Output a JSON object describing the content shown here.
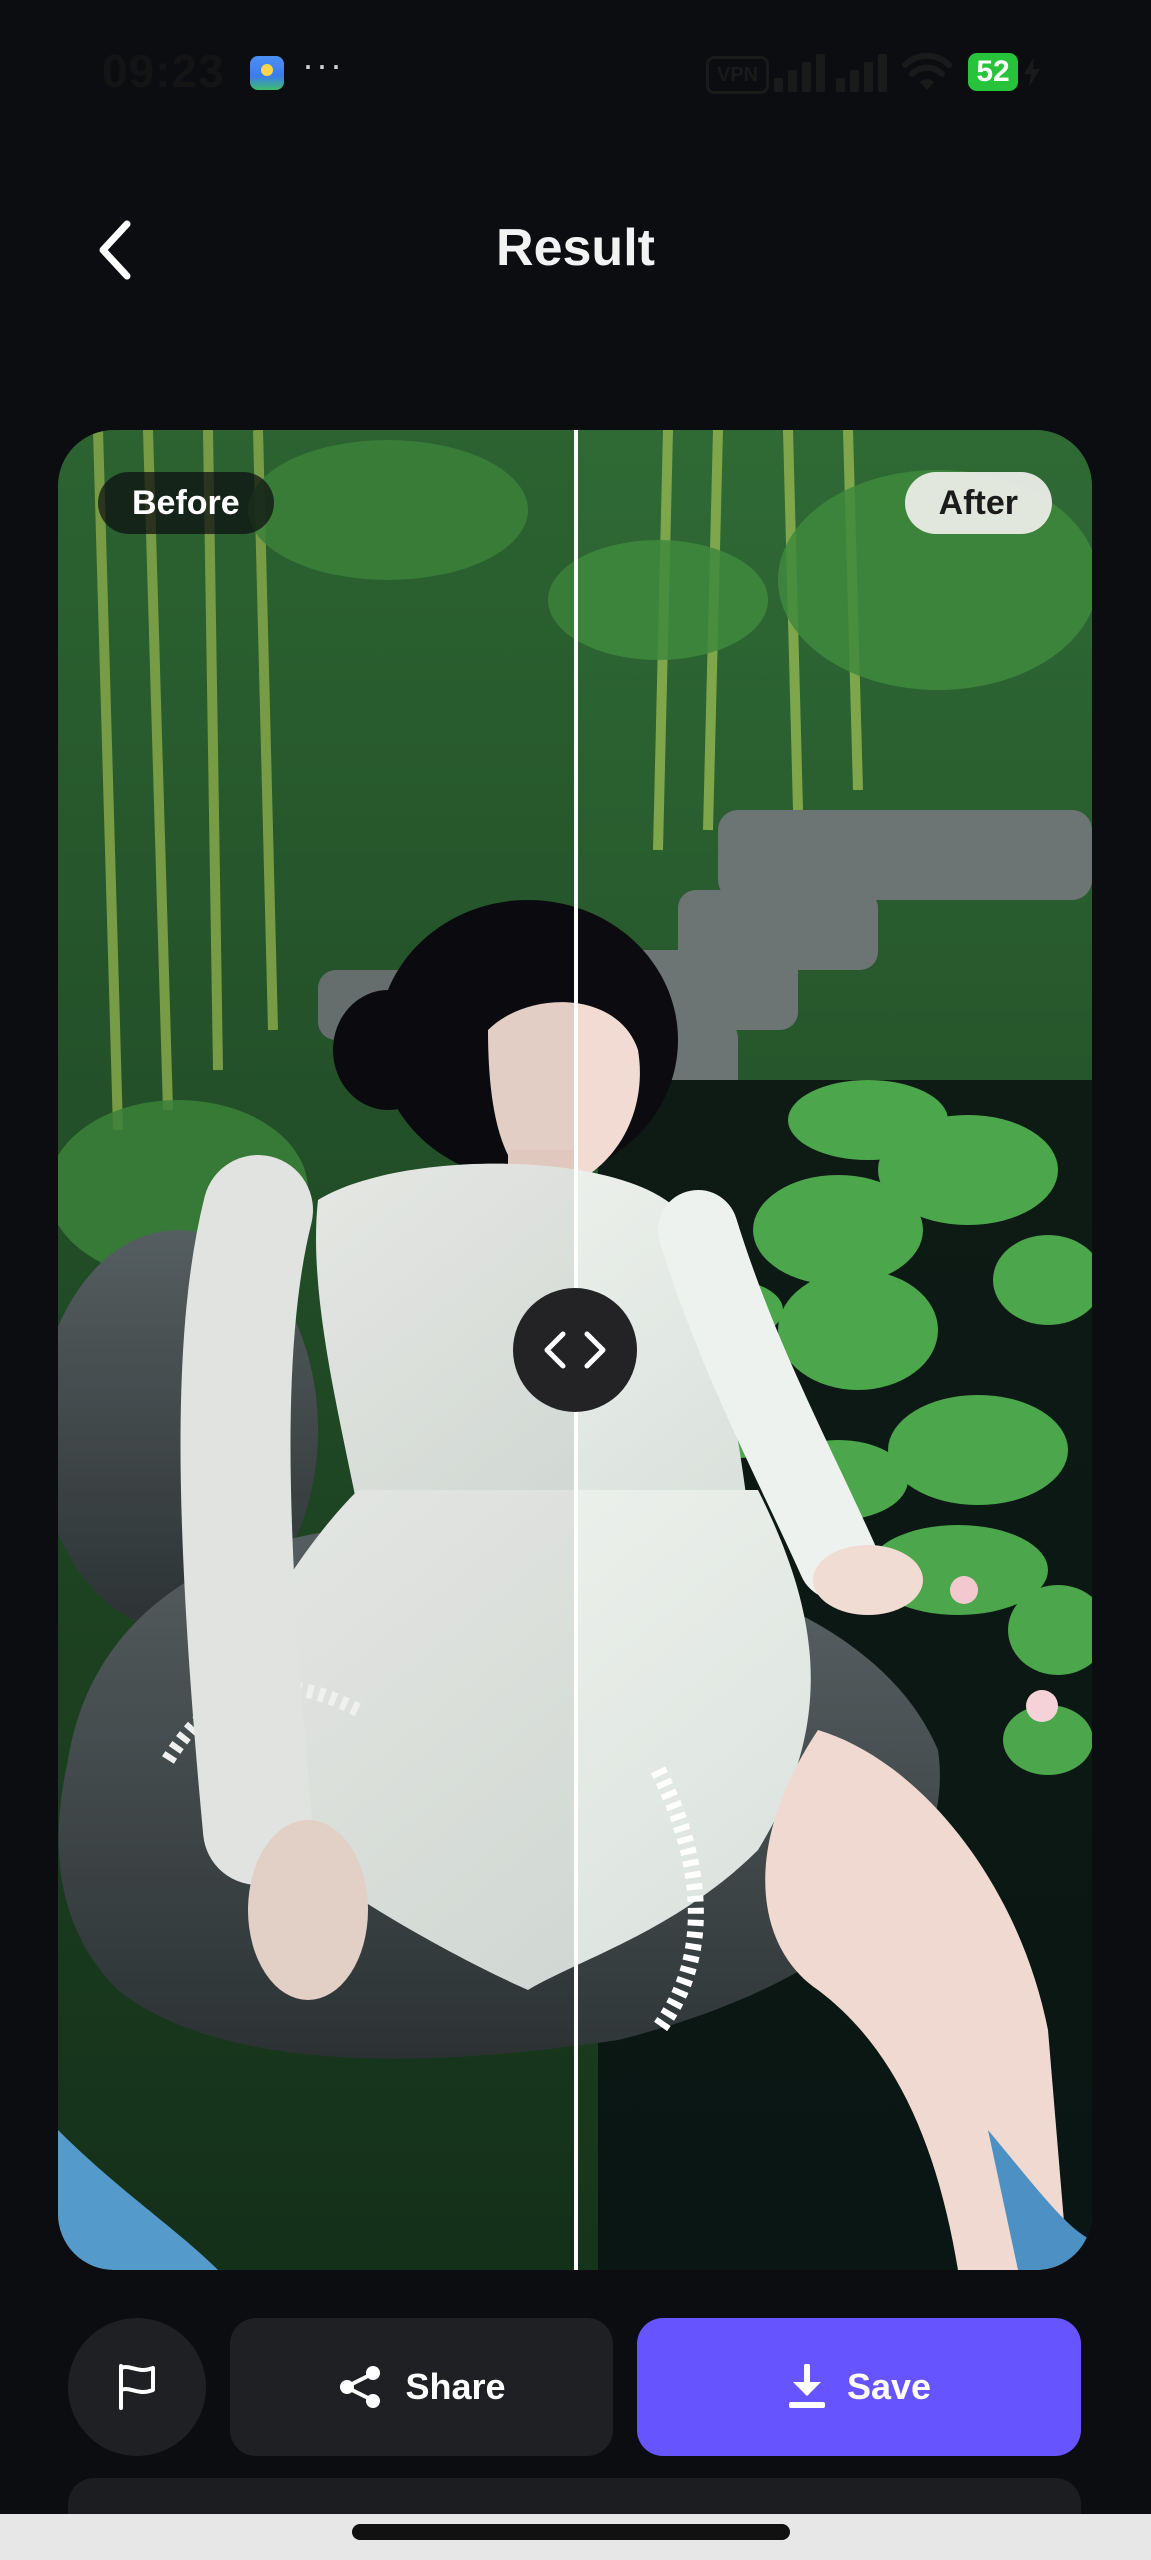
{
  "status_bar": {
    "time": "09:23",
    "dots": "···",
    "vpn": "VPN",
    "battery": "52"
  },
  "header": {
    "title": "Result"
  },
  "comparison": {
    "before_label": "Before",
    "after_label": "After"
  },
  "actions": {
    "share_label": "Share",
    "save_label": "Save"
  },
  "colors": {
    "background": "#0c0d11",
    "surface": "#1f2024",
    "accent": "#6654ff",
    "battery": "#27c33a"
  },
  "icons": {
    "back": "chevron-left-icon",
    "report": "flag-icon",
    "share": "share-icon",
    "save": "download-icon",
    "handle": "code-arrows-icon"
  }
}
